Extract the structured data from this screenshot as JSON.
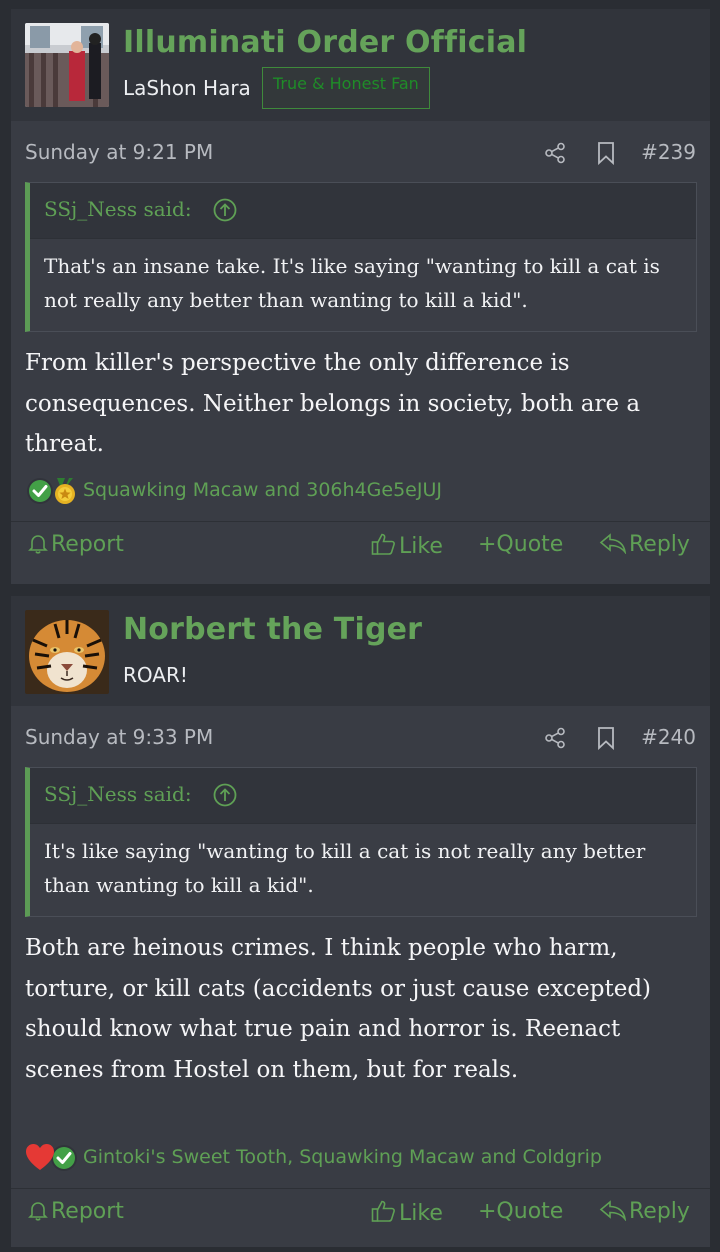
{
  "posts": [
    {
      "username": "Illuminati Order Official",
      "user_title": "LaShon Hara",
      "user_badge": "True & Honest Fan",
      "date": "Sunday at 9:21 PM",
      "post_number": "#239",
      "quote": {
        "author": "SSj_Ness said:",
        "text": "That's an insane take. It's like saying \"wanting to kill a cat is not really any better than wanting to kill a kid\"."
      },
      "message": "From killer's perspective the only difference is consequences. Neither belongs in society, both are a threat.",
      "reactions": {
        "icons": [
          "check-reaction-icon",
          "medal-reaction-icon"
        ],
        "users": "Squawking Macaw and 306h4Ge5eJUJ"
      }
    },
    {
      "username": "Norbert the Tiger",
      "user_title": "ROAR!",
      "date": "Sunday at 9:33 PM",
      "post_number": "#240",
      "quote": {
        "author": "SSj_Ness said:",
        "text": "It's like saying \"wanting to kill a cat is not really any better than wanting to kill a kid\"."
      },
      "message": "Both are heinous crimes. I think people who harm, torture, or kill cats (accidents or just cause excepted) should know what true pain and horror is. Reenact scenes from Hostel on them, but for reals.",
      "reactions": {
        "icons": [
          "heart-reaction-icon",
          "check-reaction-icon"
        ],
        "users": "Gintoki's Sweet Tooth, Squawking Macaw and Coldgrip"
      }
    }
  ],
  "actions": {
    "report": "Report",
    "like": "Like",
    "quote": "+Quote",
    "reply": "Reply"
  },
  "colors": {
    "accent": "#5fa055",
    "background": "#2a2d33",
    "post_bg": "#393c44",
    "header_bg": "#31343b"
  }
}
